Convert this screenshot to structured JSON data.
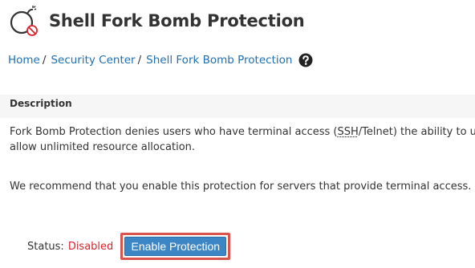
{
  "header": {
    "title": "Shell Fork Bomb Protection",
    "icon": "bomb-icon"
  },
  "breadcrumb": {
    "items": [
      "Home",
      "Security Center",
      "Shell Fork Bomb Protection"
    ],
    "separator": "/",
    "help_icon": "help-circle-icon"
  },
  "description": {
    "heading": "Description",
    "line1_before": "Fork Bomb Protection denies users who have terminal access (",
    "line1_abbr": "SSH",
    "line1_after": "/Telnet) the ability to use",
    "line2": "allow unlimited resource allocation.",
    "line3": "We recommend that you enable this protection for servers that provide terminal access."
  },
  "status": {
    "label": "Status:",
    "value": "Disabled",
    "button_label": "Enable Protection"
  },
  "colors": {
    "link": "#1f6fb2",
    "status_disabled": "#d9232d",
    "button_bg": "#3c86c6",
    "highlight_border": "#d9534f",
    "panel_bg": "#f6f6f6"
  }
}
